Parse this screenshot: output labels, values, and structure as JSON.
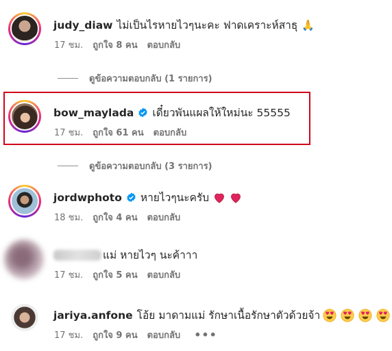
{
  "comments": [
    {
      "username": "judy_diaw",
      "text": "ไม่เป็นไรหายไวๆนะคะ ฟาดเคราะห์สาธุ",
      "emoji": "🙏",
      "time": "17 ชม.",
      "likes": "ถูกใจ 8 คน",
      "reply": "ตอบกลับ"
    },
    {
      "username": "bow_maylada",
      "text": "เดี๋ยวพันแผลให้ใหม่นะ 55555",
      "time": "17 ชม.",
      "likes": "ถูกใจ 61 คน",
      "reply": "ตอบกลับ"
    },
    {
      "username": "jordwphoto",
      "text": "หายไวๆนะครับ",
      "time": "18 ชม.",
      "likes": "ถูกใจ 4 คน",
      "reply": "ตอบกลับ"
    },
    {
      "username": "",
      "text": "แม่ หายไวๆ นะค้าาา",
      "time": "17 ชม.",
      "likes": "ถูกใจ 5 คน",
      "reply": "ตอบกลับ"
    },
    {
      "username": "jariya.anfone",
      "text": "โอ้ย มาดามแม่ รักษาเนื้อรักษาตัวด้วยจ้า",
      "time": "17 ชม.",
      "likes": "ถูกใจ 9 คน",
      "reply": "ตอบกลับ",
      "more": "•••"
    }
  ],
  "view_replies": [
    "ดูข้อความตอบกลับ (1 รายการ)",
    "ดูข้อความตอบกลับ (3 รายการ)"
  ],
  "icons": {
    "verified": "verified-badge-icon",
    "heart": "red-heart-emoji",
    "folded_hands": "folded-hands-emoji",
    "heart_eyes": "heart-eyes-emoji"
  },
  "colors": {
    "verified": "#0095f6",
    "highlight_border": "#d0021b",
    "meta_text": "#737373",
    "heart": "#e0245e"
  }
}
